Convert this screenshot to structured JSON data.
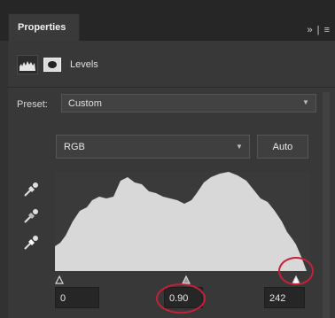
{
  "tabs": {
    "active_label": "Properties",
    "controls": "» | ≡"
  },
  "adjustment": {
    "label": "Levels"
  },
  "preset": {
    "label": "Preset:",
    "value": "Custom"
  },
  "channel": {
    "value": "RGB"
  },
  "auto_label": "Auto",
  "levels": {
    "input_black": "0",
    "input_gamma": "0.90",
    "input_white": "242"
  },
  "colors": {
    "highlight_ring": "#c5203a",
    "histogram_fill": "#d8d8d8"
  },
  "icons": [
    "histogram-icon",
    "mask-icon",
    "chevron-down-icon",
    "black-point-eyedropper-icon",
    "gray-point-eyedropper-icon",
    "white-point-eyedropper-icon"
  ]
}
